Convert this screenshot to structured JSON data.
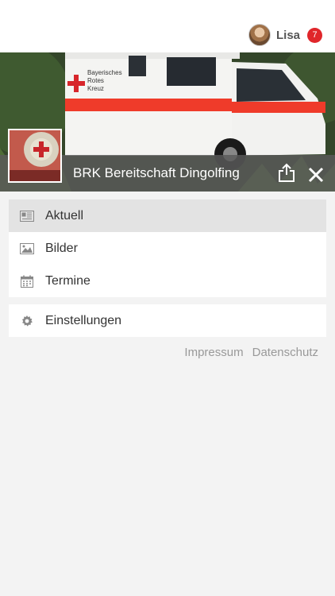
{
  "header": {
    "user_name": "Lisa",
    "notification_count": "7"
  },
  "hero": {
    "title": "BRK Bereitschaft Dingolfing"
  },
  "menu_primary": [
    {
      "label": "Aktuell",
      "icon": "newspaper-icon",
      "active": true
    },
    {
      "label": "Bilder",
      "icon": "image-icon",
      "active": false
    },
    {
      "label": "Termine",
      "icon": "calendar-icon",
      "active": false
    }
  ],
  "menu_secondary": [
    {
      "label": "Einstellungen",
      "icon": "gear-icon"
    }
  ],
  "footer": {
    "impressum": "Impressum",
    "datenschutz": "Datenschutz"
  },
  "colors": {
    "badge": "#e0262a",
    "hero_overlay": "#5a5a5a",
    "active_item": "#e3e3e3"
  }
}
